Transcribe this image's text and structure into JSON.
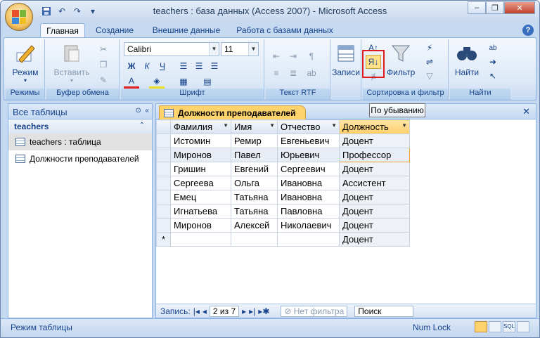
{
  "window": {
    "title": "teachers : база данных (Access 2007) - Microsoft Access"
  },
  "ribbon_tabs": [
    "Главная",
    "Создание",
    "Внешние данные",
    "Работа с базами данных"
  ],
  "groups": {
    "views": {
      "label": "Режимы",
      "btn": "Режим"
    },
    "clipboard": {
      "label": "Буфер обмена",
      "btn": "Вставить"
    },
    "font": {
      "label": "Шрифт",
      "font_name": "Calibri",
      "font_size": "11"
    },
    "rtf": {
      "label": "Текст RTF"
    },
    "records": {
      "btn": "Записи"
    },
    "sort": {
      "label": "Сортировка и фильтр",
      "filter_btn": "Фильтр"
    },
    "find": {
      "label": "Найти",
      "btn": "Найти"
    }
  },
  "tooltip": "По убыванию",
  "nav": {
    "header": "Все таблицы",
    "group": "teachers",
    "items": [
      "teachers : таблица",
      "Должности преподавателей"
    ]
  },
  "doc_tab": "Должности преподавателей",
  "columns": [
    "Фамилия",
    "Имя",
    "Отчество",
    "Должность"
  ],
  "rows": [
    [
      "Истомин",
      "Ремир",
      "Евгеньевич",
      "Доцент"
    ],
    [
      "Миронов",
      "Павел",
      "Юрьевич",
      "Профессор"
    ],
    [
      "Гришин",
      "Евгений",
      "Сергеевич",
      "Доцент"
    ],
    [
      "Сергеева",
      "Ольга",
      "Ивановна",
      "Ассистент"
    ],
    [
      "Емец",
      "Татьяна",
      "Ивановна",
      "Доцент"
    ],
    [
      "Игнатьева",
      "Татьяна",
      "Павловна",
      "Доцент"
    ],
    [
      "Миронов",
      "Алексей",
      "Николаевич",
      "Доцент"
    ]
  ],
  "new_row": {
    "marker": "*",
    "default_value": "Доцент"
  },
  "record_nav": {
    "label": "Запись:",
    "position": "2 из 7",
    "filter": "Нет фильтра",
    "search": "Поиск"
  },
  "status": {
    "left": "Режим таблицы",
    "numlock": "Num Lock",
    "views": [
      "",
      "",
      "SQL",
      ""
    ]
  }
}
